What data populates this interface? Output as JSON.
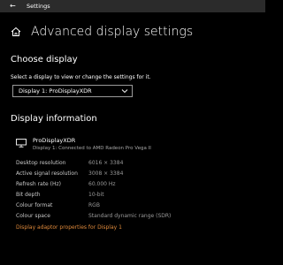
{
  "window": {
    "title": "Settings",
    "back_icon": "back-arrow-icon"
  },
  "page": {
    "title": "Advanced display settings",
    "home_icon": "home-icon"
  },
  "choose_display": {
    "heading": "Choose display",
    "description": "Select a display to view or change the settings for it.",
    "selected": "Display 1: ProDisplayXDR"
  },
  "display_information": {
    "heading": "Display information",
    "monitor_icon": "monitor-icon",
    "display_name": "ProDisplayXDR",
    "connection": "Display 1: Connected to AMD Radeon Pro Vega II",
    "rows": [
      {
        "label": "Desktop resolution",
        "value": "6016 × 3384"
      },
      {
        "label": "Active signal resolution",
        "value": "3008 × 3384"
      },
      {
        "label": "Refresh rate (Hz)",
        "value": "60.000 Hz"
      },
      {
        "label": "Bit depth",
        "value": "10-bit"
      },
      {
        "label": "Colour format",
        "value": "RGB"
      },
      {
        "label": "Colour space",
        "value": "Standard dynamic range (SDR)"
      }
    ],
    "adapter_link": "Display adaptor properties for Display 1"
  },
  "colors": {
    "background": "#000000",
    "titlebar": "#2b2b2b",
    "link": "#e08a3b",
    "secondary_text": "#9a9a9a"
  }
}
